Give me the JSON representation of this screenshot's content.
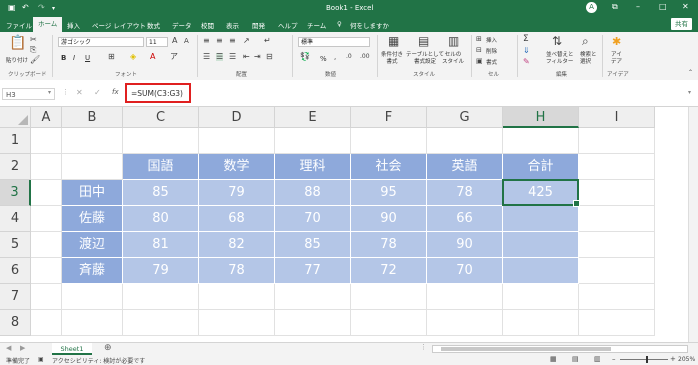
{
  "title_bar": {
    "save_icon": "save-icon",
    "undo_icon": "undo-icon",
    "redo_icon": "redo-icon",
    "title": "Book1 - Excel",
    "account_initial": "A",
    "colors": {
      "brand": "#217346"
    }
  },
  "ribbon_tabs": {
    "items": [
      "ファイル",
      "ホーム",
      "挿入",
      "ページ レイアウト",
      "数式",
      "データ",
      "校閲",
      "表示",
      "開発",
      "ヘルプ",
      "チーム"
    ],
    "active": "ホーム",
    "tell_me": "何をしますか",
    "share": "共有"
  },
  "ribbon": {
    "clipboard": {
      "paste": "貼り付け",
      "label": "クリップボード"
    },
    "font": {
      "name": "游ゴシック",
      "size": "11",
      "label": "フォント",
      "bold": "B",
      "italic": "I",
      "underline": "U"
    },
    "alignment": {
      "label": "配置"
    },
    "number": {
      "format": "標準",
      "label": "数値",
      "percent": "%"
    },
    "styles": {
      "conditional": "条件付き\n書式",
      "table": "テーブルとして\n書式設定",
      "cell": "セルの\nスタイル",
      "label": "スタイル"
    },
    "cells": {
      "insert": "挿入",
      "delete": "削除",
      "format": "書式",
      "label": "セル"
    },
    "editing": {
      "sort": "並べ替えと\nフィルター",
      "find": "検索と\n選択",
      "label": "編集"
    },
    "ideas": {
      "text": "アイ\nデア",
      "label": "アイデア"
    }
  },
  "formula_bar": {
    "name_box": "H3",
    "fx": "fx",
    "formula": "=SUM(C3:G3)"
  },
  "sheet": {
    "columns": [
      "A",
      "B",
      "C",
      "D",
      "E",
      "F",
      "G",
      "H",
      "I"
    ],
    "rows": [
      "1",
      "2",
      "3",
      "4",
      "5",
      "6",
      "7",
      "8"
    ],
    "header_row": [
      "国語",
      "数学",
      "理科",
      "社会",
      "英語",
      "合計"
    ],
    "names": [
      "田中",
      "佐藤",
      "渡辺",
      "斉藤"
    ],
    "scores": [
      [
        "85",
        "79",
        "88",
        "95",
        "78",
        "425"
      ],
      [
        "80",
        "68",
        "70",
        "90",
        "66",
        ""
      ],
      [
        "81",
        "82",
        "85",
        "78",
        "90",
        ""
      ],
      [
        "79",
        "78",
        "77",
        "72",
        "70",
        ""
      ]
    ],
    "active_cell": "H3",
    "colors": {
      "header_fill": "#8ea9db",
      "data_fill": "#b4c6e7"
    }
  },
  "sheet_tabs": {
    "active": "Sheet1",
    "add_icon": "plus-icon"
  },
  "status_bar": {
    "ready": "準備完了",
    "accessibility": "アクセシビリティ: 検討が必要です",
    "zoom": "205%"
  }
}
